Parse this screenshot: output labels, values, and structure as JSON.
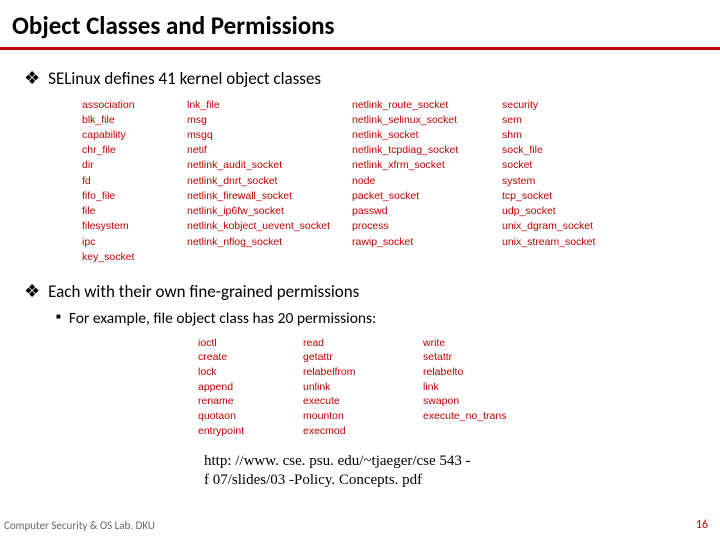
{
  "title": "Object Classes and Permissions",
  "bullet1": "SELinux defines 41 kernel object classes",
  "classes": {
    "c1": [
      "association",
      "blk_file",
      "capability",
      "chr_file",
      "dir",
      "fd",
      "fifo_file",
      "file",
      "filesystem",
      "ipc",
      "key_socket"
    ],
    "c2": [
      "lnk_file",
      "msg",
      "msgq",
      "netif",
      "netlink_audit_socket",
      "netlink_dnrt_socket",
      "netlink_firewall_socket",
      "netlink_ip6fw_socket",
      "netlink_kobject_uevent_socket",
      "netlink_nflog_socket"
    ],
    "c3": [
      "netlink_route_socket",
      "netlink_selinux_socket",
      "netlink_socket",
      "netlink_tcpdiag_socket",
      "netlink_xfrm_socket",
      "node",
      "packet_socket",
      "passwd",
      "process",
      "rawip_socket"
    ],
    "c4": [
      "security",
      "sem",
      "shm",
      "sock_file",
      "socket",
      "system",
      "tcp_socket",
      "udp_socket",
      "unix_dgram_socket",
      "unix_stream_socket"
    ]
  },
  "bullet2": "Each with their own fine-grained permissions",
  "bullet2a": "For example, file object class has 20 permissions:",
  "perms": {
    "p1": [
      "ioctl",
      "create",
      "lock",
      "append",
      "rename",
      "quotaon",
      "entrypoint"
    ],
    "p2": [
      "read",
      "getattr",
      "relabelfrom",
      "unlink",
      "execute",
      "mounton",
      "execmod"
    ],
    "p3": [
      "write",
      "setattr",
      "relabelto",
      "link",
      "swapon",
      "execute_no_trans"
    ]
  },
  "url_l1": "http: //www. cse. psu. edu/~tjaeger/cse 543 -",
  "url_l2": "f 07/slides/03 -Policy. Concepts. pdf",
  "footer": "Computer Security & OS Lab. DKU",
  "page": "16"
}
